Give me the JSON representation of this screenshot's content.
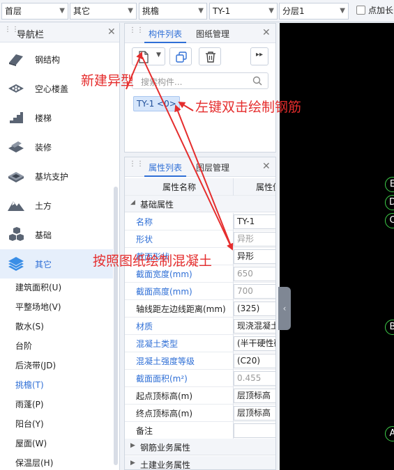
{
  "toolbar": {
    "floor": "首层",
    "category": "其它",
    "component_type": "挑檐",
    "component": "TY-1",
    "layer": "分层1",
    "checkbox_label": "点加长"
  },
  "nav": {
    "title": "导航栏",
    "items": [
      {
        "label": "钢结构",
        "icon": "steel-structure-icon"
      },
      {
        "label": "空心楼盖",
        "icon": "hollow-floor-icon"
      },
      {
        "label": "楼梯",
        "icon": "stairs-icon"
      },
      {
        "label": "装修",
        "icon": "decoration-icon"
      },
      {
        "label": "基坑支护",
        "icon": "foundation-pit-icon"
      },
      {
        "label": "土方",
        "icon": "earthwork-icon"
      },
      {
        "label": "基础",
        "icon": "foundation-icon"
      },
      {
        "label": "其它",
        "icon": "other-layers-icon"
      }
    ],
    "sub_items": [
      "建筑面积(U)",
      "平整场地(V)",
      "散水(S)",
      "台阶",
      "后浇带(JD)",
      "挑檐(T)",
      "雨蓬(P)",
      "阳台(Y)",
      "屋面(W)",
      "保温层(H)"
    ],
    "active_sub": "挑檐(T)"
  },
  "component_panel": {
    "tabs": [
      "构件列表",
      "图纸管理"
    ],
    "search_placeholder": "搜索构件...",
    "selected_component": "TY-1 <0>"
  },
  "property_panel": {
    "tabs": [
      "属性列表",
      "图层管理"
    ],
    "col_name": "属性名称",
    "col_value": "属性值",
    "group_basic": "基础属性",
    "rows": [
      {
        "name": "名称",
        "value": "TY-1",
        "blue": true,
        "grey": false
      },
      {
        "name": "形状",
        "value": "异形",
        "blue": true,
        "grey": true
      },
      {
        "name": "截面形状",
        "value": "异形",
        "blue": true,
        "grey": false
      },
      {
        "name": "截面宽度(mm)",
        "value": "650",
        "blue": true,
        "grey": true
      },
      {
        "name": "截面高度(mm)",
        "value": "700",
        "blue": true,
        "grey": true
      },
      {
        "name": "轴线距左边线距离(mm)",
        "value": "(325)",
        "blue": false,
        "grey": false
      },
      {
        "name": "材质",
        "value": "现浇混凝土",
        "blue": true,
        "grey": false
      },
      {
        "name": "混凝土类型",
        "value": "(半干硬性砼",
        "blue": true,
        "grey": false
      },
      {
        "name": "混凝土强度等级",
        "value": "(C20)",
        "blue": true,
        "grey": false
      },
      {
        "name": "截面面积(m²)",
        "value": "0.455",
        "blue": true,
        "grey": true
      },
      {
        "name": "起点顶标高(m)",
        "value": "层顶标高",
        "blue": false,
        "grey": false
      },
      {
        "name": "终点顶标高(m)",
        "value": "层顶标高",
        "blue": false,
        "grey": false
      },
      {
        "name": "备注",
        "value": "",
        "blue": false,
        "grey": false
      }
    ],
    "group_rebar": "钢筋业务属性",
    "group_civil": "土建业务属性"
  },
  "canvas": {
    "markers": [
      "E",
      "D",
      "C",
      "B",
      "A"
    ]
  },
  "annotations": {
    "new_shape": "新建异型",
    "double_click": "左键双击绘制钢筋",
    "draw_concrete": "按照图纸绘制混凝土"
  },
  "colors": {
    "annotation": "#e52d2d",
    "accent": "#2f6fd6",
    "marker": "#3fd04a"
  }
}
